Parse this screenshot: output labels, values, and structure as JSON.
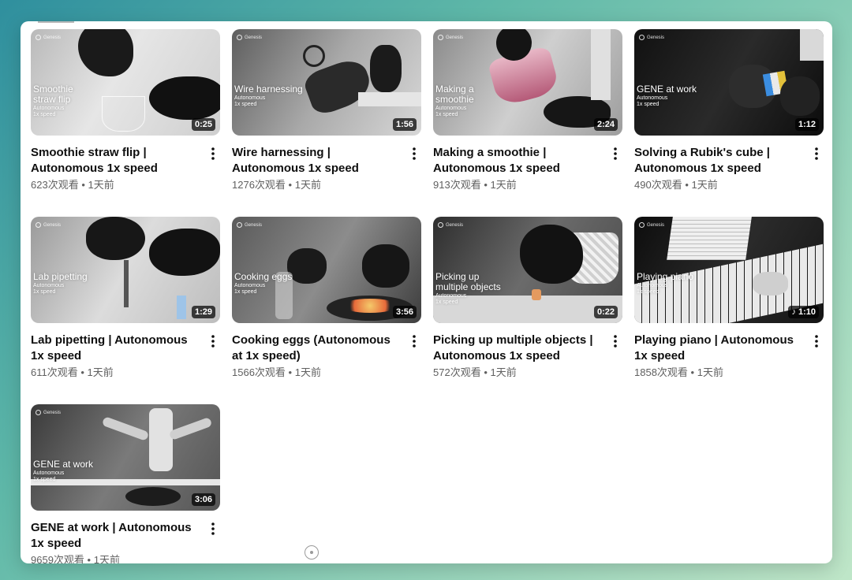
{
  "thumb_brand": "Genesis",
  "colors": {
    "title": "#0f0f0f",
    "meta": "#606060",
    "duration_bg": "#000000"
  },
  "videos": [
    {
      "title": "Smoothie straw flip | Autonomous 1x speed",
      "views": "623次观看",
      "age": "1天前",
      "duration": "0:25",
      "thumb_title": "Smoothie\nstraw flip",
      "thumb_sub": "Autonomous\n1x speed"
    },
    {
      "title": "Wire harnessing | Autonomous 1x speed",
      "views": "1276次观看",
      "age": "1天前",
      "duration": "1:56",
      "thumb_title": "Wire harnessing",
      "thumb_sub": "Autonomous\n1x speed"
    },
    {
      "title": "Making a smoothie | Autonomous 1x speed",
      "views": "913次观看",
      "age": "1天前",
      "duration": "2:24",
      "thumb_title": "Making a\nsmoothie",
      "thumb_sub": "Autonomous\n1x speed"
    },
    {
      "title": "Solving a Rubik's cube | Autonomous 1x speed",
      "views": "490次观看",
      "age": "1天前",
      "duration": "1:12",
      "thumb_title": "GENE at work",
      "thumb_sub": "Autonomous\n1x speed"
    },
    {
      "title": "Lab pipetting | Autonomous 1x speed",
      "views": "611次观看",
      "age": "1天前",
      "duration": "1:29",
      "thumb_title": "Lab pipetting",
      "thumb_sub": "Autonomous\n1x speed"
    },
    {
      "title": "Cooking eggs (Autonomous at 1x speed)",
      "views": "1566次观看",
      "age": "1天前",
      "duration": "3:56",
      "thumb_title": "Cooking eggs",
      "thumb_sub": "Autonomous\n1x speed"
    },
    {
      "title": "Picking up multiple objects | Autonomous 1x speed",
      "views": "572次观看",
      "age": "1天前",
      "duration": "0:22",
      "thumb_title": "Picking up\nmultiple objects",
      "thumb_sub": "Autonomous\n1x speed"
    },
    {
      "title": "Playing piano | Autonomous 1x speed",
      "views": "1858次观看",
      "age": "1天前",
      "duration": "1:10",
      "music": true,
      "thumb_title": "Playing piano",
      "thumb_sub": "Autonomous\n1x speed"
    },
    {
      "title": "GENE at work | Autonomous 1x speed",
      "views": "9659次观看",
      "age": "1天前",
      "duration": "3:06",
      "thumb_title": "GENE at work",
      "thumb_sub": "Autonomous\n1x speed"
    }
  ]
}
